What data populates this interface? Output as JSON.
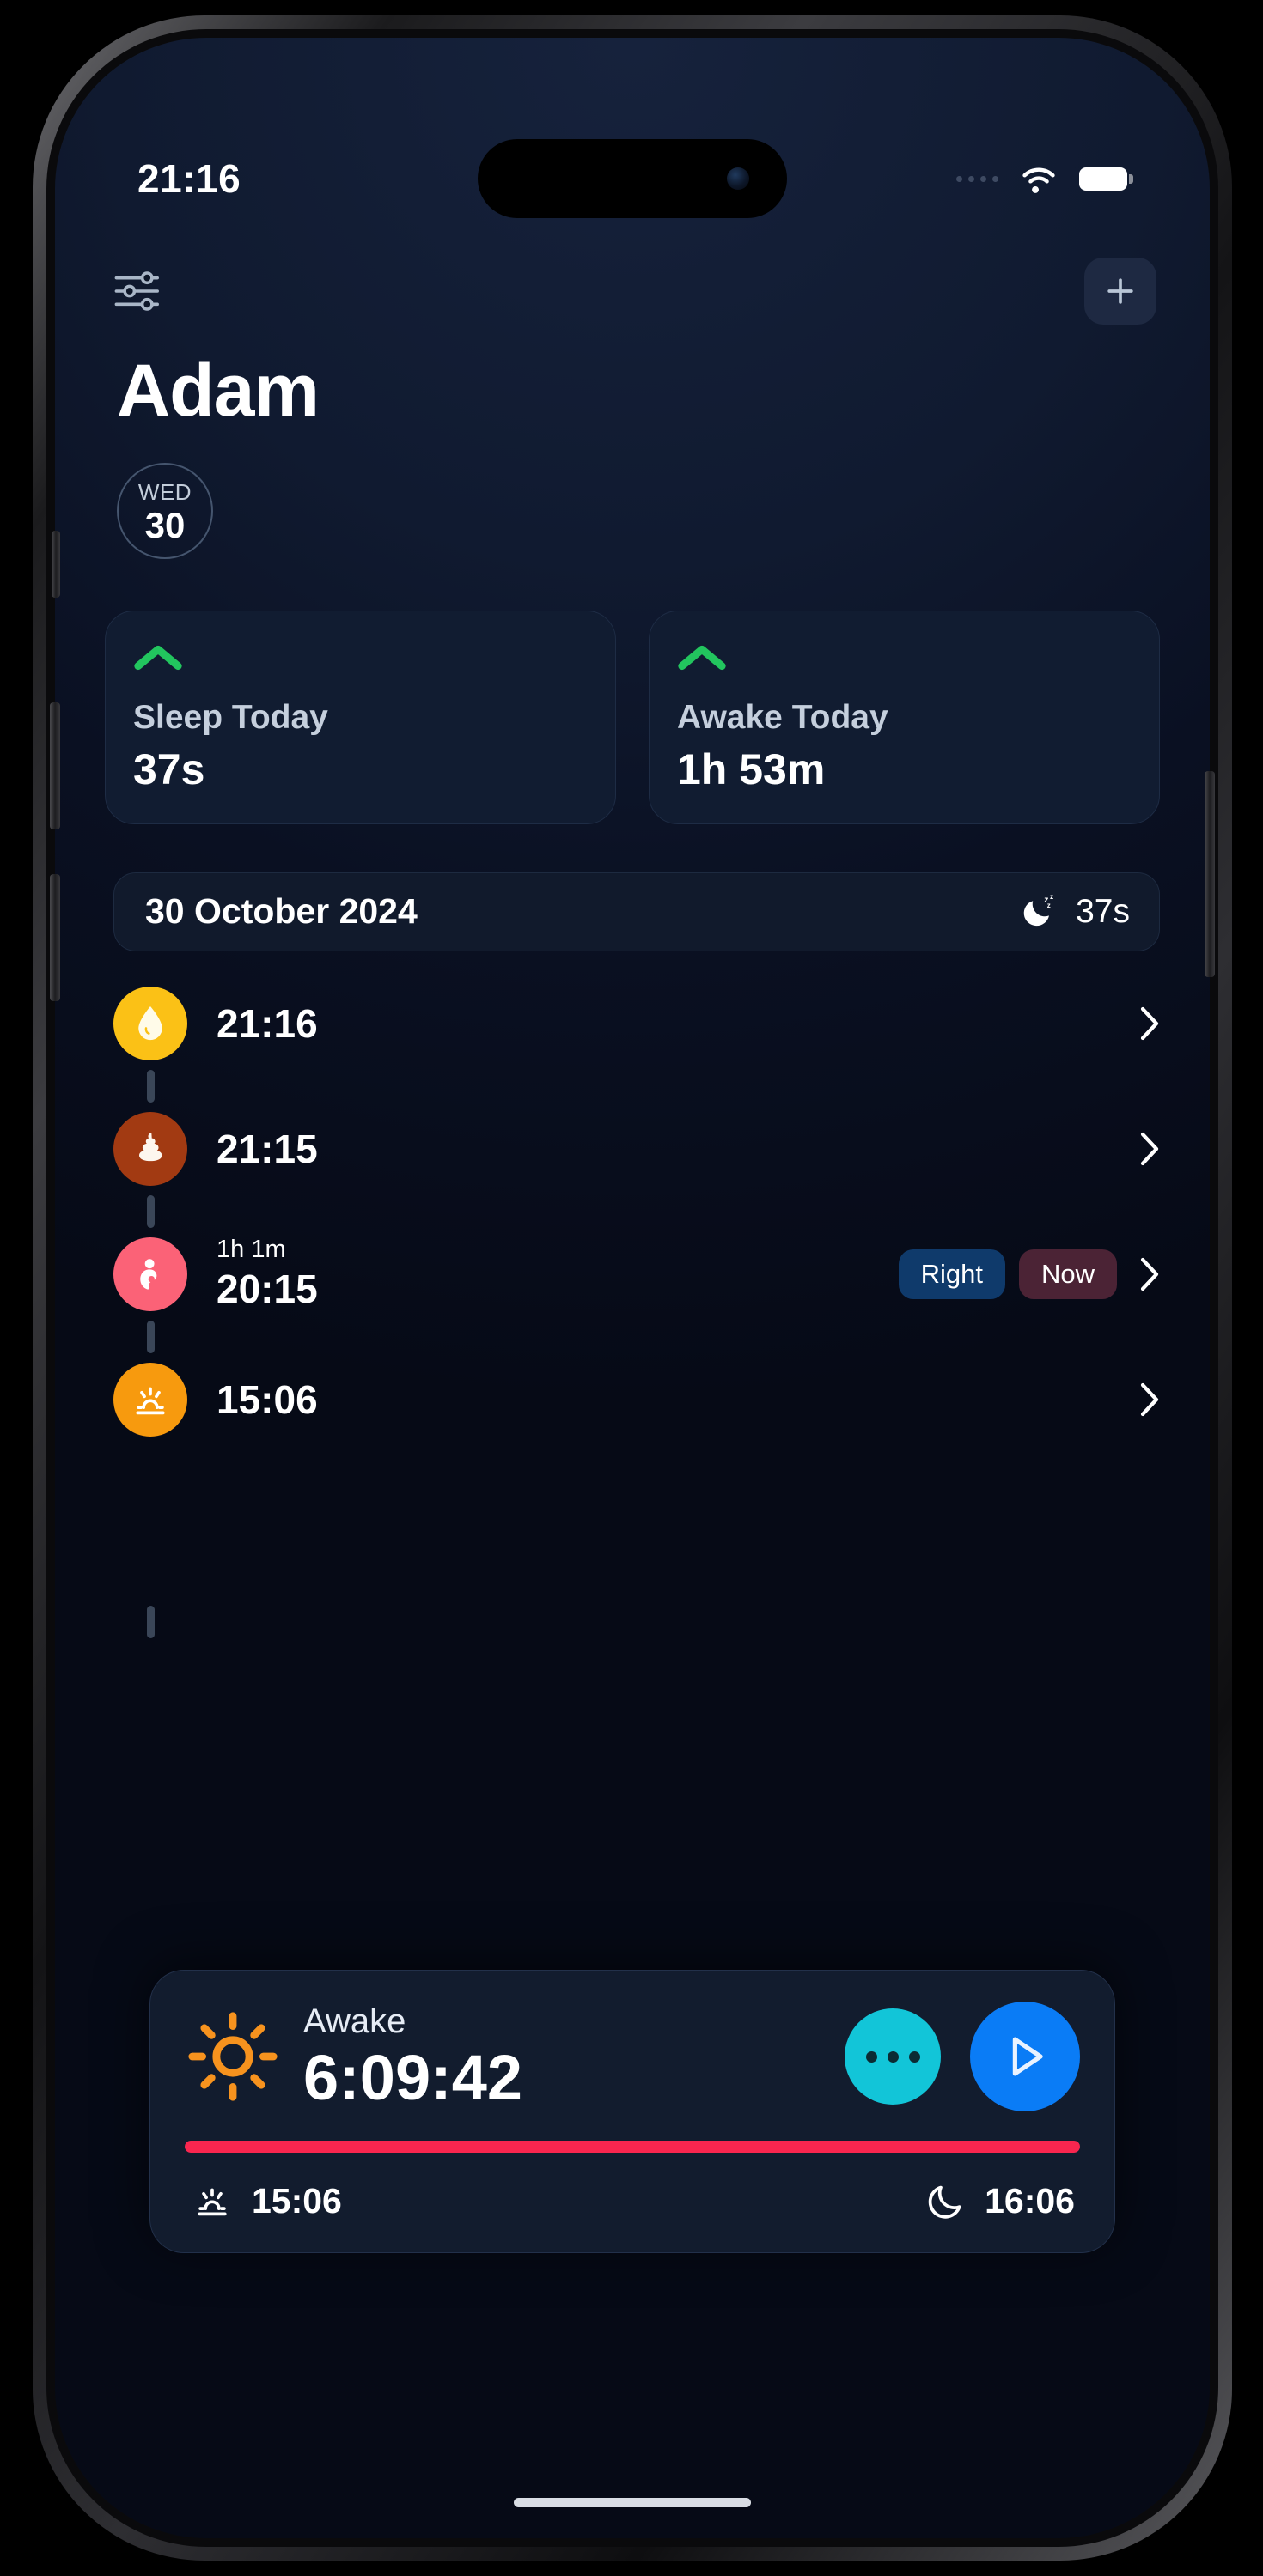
{
  "status_bar": {
    "time": "21:16",
    "signal_icon": "signal-dots-icon",
    "wifi_icon": "wifi-icon",
    "battery_icon": "battery-full-icon"
  },
  "header": {
    "filter_icon": "sliders-icon",
    "add_icon": "plus-icon",
    "baby_name": "Adam",
    "day_of_week": "WED",
    "day_number": "30"
  },
  "stat_cards": [
    {
      "trend_icon": "chevron-up-icon",
      "trend_color": "#22c55e",
      "label": "Sleep Today",
      "value": "37s"
    },
    {
      "trend_icon": "chevron-up-icon",
      "trend_color": "#22c55e",
      "label": "Awake Today",
      "value": "1h 53m"
    }
  ],
  "date_bar": {
    "date": "30 October 2024",
    "sleep_icon": "moon-zzz-icon",
    "sleep_total": "37s"
  },
  "timeline": [
    {
      "icon": "droplet-icon",
      "icon_bg": "#fbc116",
      "duration": "",
      "time": "21:16",
      "badges": [],
      "chevron_icon": "chevron-right-icon"
    },
    {
      "icon": "poop-icon",
      "icon_bg": "#a23a12",
      "duration": "",
      "time": "21:15",
      "badges": [],
      "chevron_icon": "chevron-right-icon"
    },
    {
      "icon": "nursing-icon",
      "icon_bg": "#fb6277",
      "duration": "1h 1m",
      "time": "20:15",
      "badges": [
        {
          "label": "Right",
          "color": "#0f3a6b"
        },
        {
          "label": "Now",
          "color": "#4b2335"
        }
      ],
      "chevron_icon": "chevron-right-icon"
    },
    {
      "icon": "sunrise-icon",
      "icon_bg": "#f79a0e",
      "duration": "",
      "time": "15:06",
      "badges": [],
      "chevron_icon": "chevron-right-icon"
    }
  ],
  "timer_card": {
    "state_icon": "sun-icon",
    "state_label": "Awake",
    "elapsed": "6:09:42",
    "more_icon": "ellipsis-icon",
    "play_icon": "play-icon",
    "progress_percent": 100,
    "progress_color": "#f9264f",
    "start_icon": "sunrise-icon",
    "start_time": "15:06",
    "end_icon": "moon-icon",
    "end_time": "16:06"
  }
}
